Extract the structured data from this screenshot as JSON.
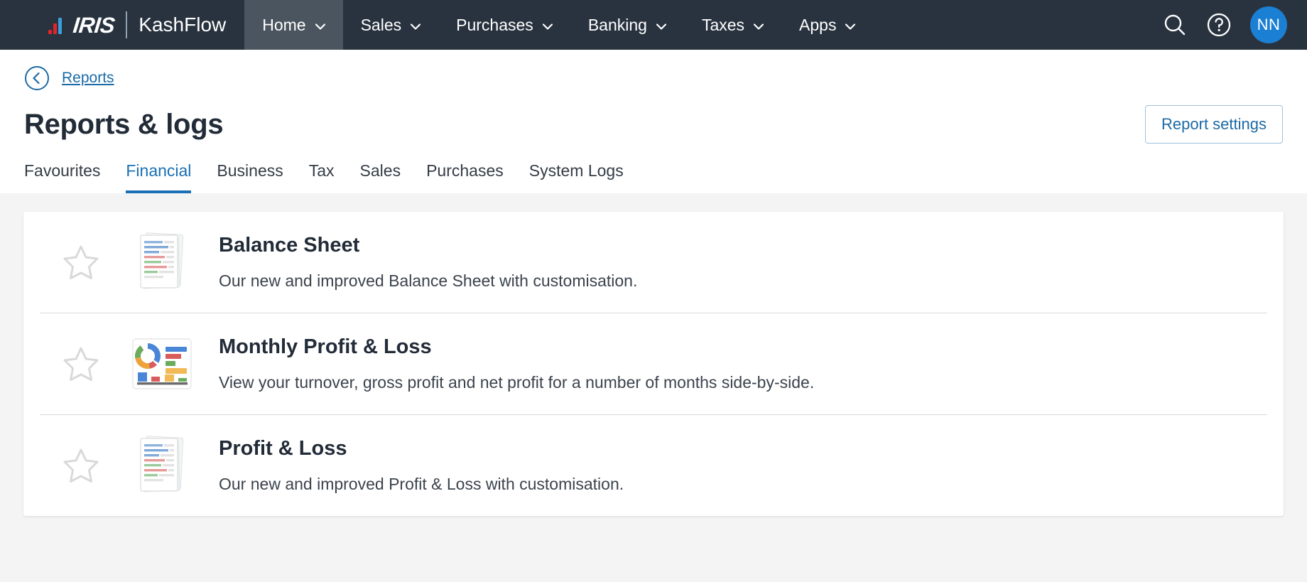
{
  "topbar": {
    "logo": {
      "name": "IRIS",
      "suffix": "KashFlow"
    },
    "nav": [
      {
        "label": "Home",
        "icon": "chevron-down-icon",
        "active": true
      },
      {
        "label": "Sales",
        "icon": "chevron-down-icon",
        "active": false
      },
      {
        "label": "Purchases",
        "icon": "chevron-down-icon",
        "active": false
      },
      {
        "label": "Banking",
        "icon": "chevron-down-icon",
        "active": false
      },
      {
        "label": "Taxes",
        "icon": "chevron-down-icon",
        "active": false
      },
      {
        "label": "Apps",
        "icon": "chevron-down-icon",
        "active": false
      }
    ],
    "search_icon": "search-icon",
    "help_icon": "help-circle-icon",
    "avatar_initials": "NN"
  },
  "breadcrumb": {
    "back_icon": "back-circle-icon",
    "link": "Reports"
  },
  "header": {
    "title": "Reports & logs",
    "settings_button": "Report settings"
  },
  "tabs": [
    {
      "label": "Favourites",
      "active": false
    },
    {
      "label": "Financial",
      "active": true
    },
    {
      "label": "Business",
      "active": false
    },
    {
      "label": "Tax",
      "active": false
    },
    {
      "label": "Sales",
      "active": false
    },
    {
      "label": "Purchases",
      "active": false
    },
    {
      "label": "System Logs",
      "active": false
    }
  ],
  "reports": [
    {
      "favourite_icon": "star-outline-icon",
      "thumb_icon": "documents-icon",
      "title": "Balance Sheet",
      "description": "Our new and improved Balance Sheet with customisation."
    },
    {
      "favourite_icon": "star-outline-icon",
      "thumb_icon": "analytics-dashboard-icon",
      "title": "Monthly Profit & Loss",
      "description": "View your turnover, gross profit and net profit for a number of months side-by-side."
    },
    {
      "favourite_icon": "star-outline-icon",
      "thumb_icon": "documents-icon",
      "title": "Profit & Loss",
      "description": "Our new and improved Profit & Loss with customisation."
    }
  ],
  "colors": {
    "topbar_bg": "#29333f",
    "nav_active_bg": "#4b555f",
    "accent_blue": "#1a6fb5",
    "avatar_bg": "#1b7fd4",
    "page_bg": "#f4f4f4",
    "logo_red": "#e0242c",
    "logo_blue": "#3aa0dc"
  }
}
